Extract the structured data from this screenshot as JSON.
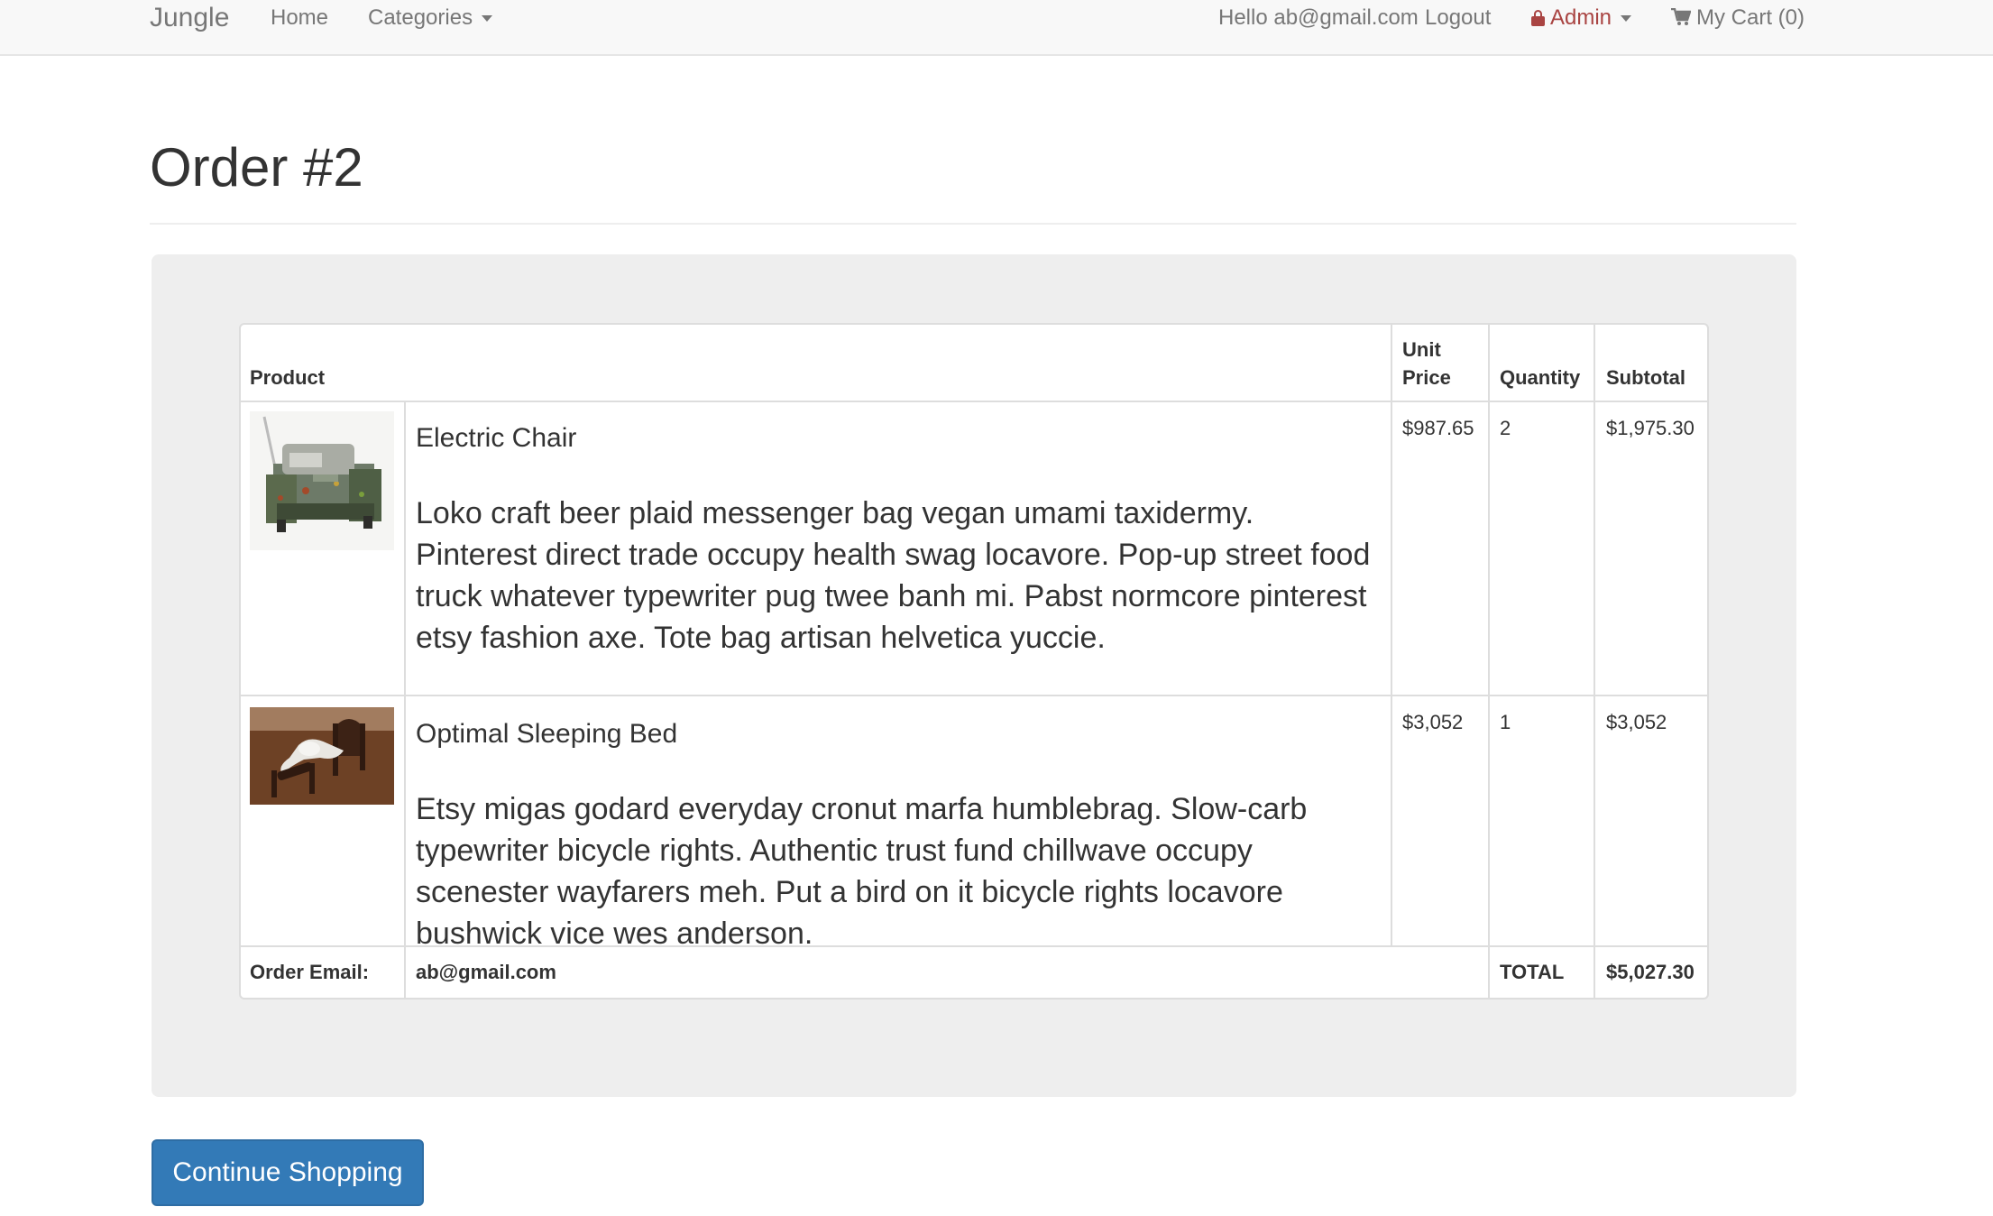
{
  "navbar": {
    "brand": "Jungle",
    "home": "Home",
    "categories": "Categories",
    "greeting": "Hello ab@gmail.com",
    "logout": "Logout",
    "admin": "Admin",
    "cart": "My Cart (0)"
  },
  "page": {
    "title": "Order #2"
  },
  "table": {
    "headers": {
      "product": "Product",
      "unit_price_line1": "Unit",
      "unit_price_line2": "Price",
      "quantity": "Quantity",
      "subtotal": "Subtotal"
    },
    "rows": [
      {
        "name": "Electric Chair",
        "description": "Loko craft beer plaid messenger bag vegan umami taxidermy. Pinterest direct trade occupy health swag locavore. Pop-up street food truck whatever typewriter pug twee banh mi. Pabst normcore pinterest etsy fashion axe. Tote bag artisan helvetica yuccie.",
        "unit_price": "$987.65",
        "quantity": "2",
        "subtotal": "$1,975.30",
        "image_icon": "electric-chair-image"
      },
      {
        "name": "Optimal Sleeping Bed",
        "description": "Etsy migas godard everyday cronut marfa humblebrag. Slow-carb typewriter bicycle rights. Authentic trust fund chillwave occupy scenester wayfarers meh. Put a bird on it bicycle rights locavore bushwick vice wes anderson.",
        "unit_price": "$3,052",
        "quantity": "1",
        "subtotal": "$3,052",
        "image_icon": "sleeping-bed-image"
      }
    ],
    "footer": {
      "email_label": "Order Email:",
      "email_value": "ab@gmail.com",
      "total_label": "TOTAL",
      "total_value": "$5,027.30"
    }
  },
  "actions": {
    "continue_shopping": "Continue Shopping"
  },
  "colors": {
    "primary": "#337ab7",
    "admin": "#a94442",
    "well": "#eeeeee",
    "navbar": "#f8f8f8"
  }
}
